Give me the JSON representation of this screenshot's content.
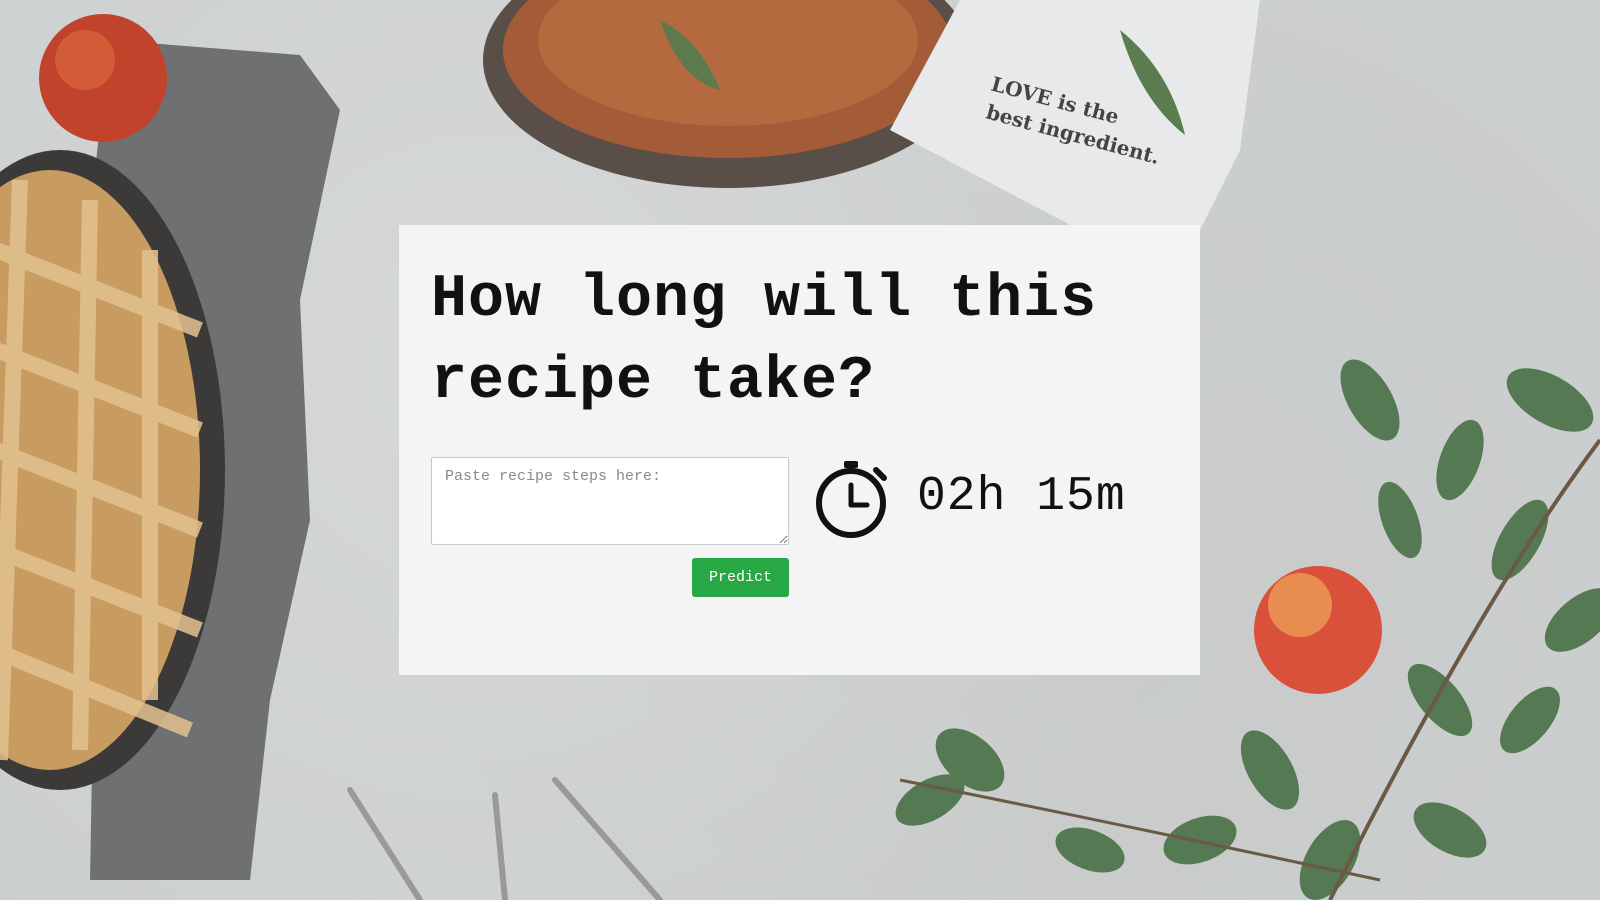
{
  "background": {
    "napkin_text_line1": "LOVE is the",
    "napkin_text_line2": "best ingredient."
  },
  "card": {
    "title": "How long will this recipe take?",
    "input": {
      "placeholder": "Paste recipe steps here:",
      "value": ""
    },
    "predict_label": "Predict",
    "predicted_time": "02h 15m",
    "stopwatch_icon": "stopwatch-icon"
  },
  "colors": {
    "predict_button": "#28a745",
    "card_background": "#f6f6f5",
    "text": "#111111"
  }
}
